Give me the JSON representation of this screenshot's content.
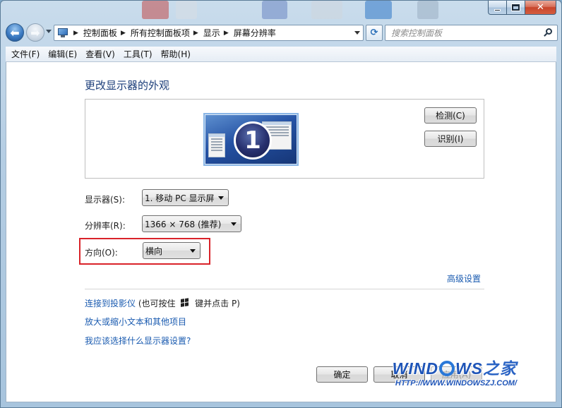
{
  "window": {
    "caption": {
      "minimize": "",
      "maximize": "",
      "close": "✕"
    }
  },
  "address": {
    "breadcrumbs": [
      "控制面板",
      "所有控制面板项",
      "显示",
      "屏幕分辨率"
    ],
    "separator": "▶"
  },
  "search": {
    "placeholder": "搜索控制面板"
  },
  "menu": [
    "文件(F)",
    "编辑(E)",
    "查看(V)",
    "工具(T)",
    "帮助(H)"
  ],
  "content": {
    "title": "更改显示器的外观",
    "monitor_number": "1",
    "detect_label": "检测(C)",
    "identify_label": "识别(I)",
    "display": {
      "label": "显示器(S):",
      "value": "1. 移动 PC 显示屏"
    },
    "resolution": {
      "label": "分辨率(R):",
      "value": "1366 × 768 (推荐)"
    },
    "orientation": {
      "label": "方向(O):",
      "value": "横向"
    },
    "advanced_link": "高级设置",
    "links": {
      "projector": "连接到投影仪",
      "projector_hint_before": " (也可按住 ",
      "projector_hint_after": " 键并点击 P)",
      "text_size": "放大或缩小文本和其他项目",
      "which_settings": "我应该选择什么显示器设置?"
    },
    "ok_label": "确定",
    "cancel_label": "取消",
    "apply_label": "应用(A)"
  },
  "watermark": {
    "part1": "WIND",
    "part2": "WS",
    "suffix": "之家",
    "url": "HTTP://WWW.WINDOWSZJ.COM/"
  },
  "colors": {
    "link": "#1a5bb0",
    "title": "#1c3e7a",
    "highlight": "#d9232a"
  }
}
